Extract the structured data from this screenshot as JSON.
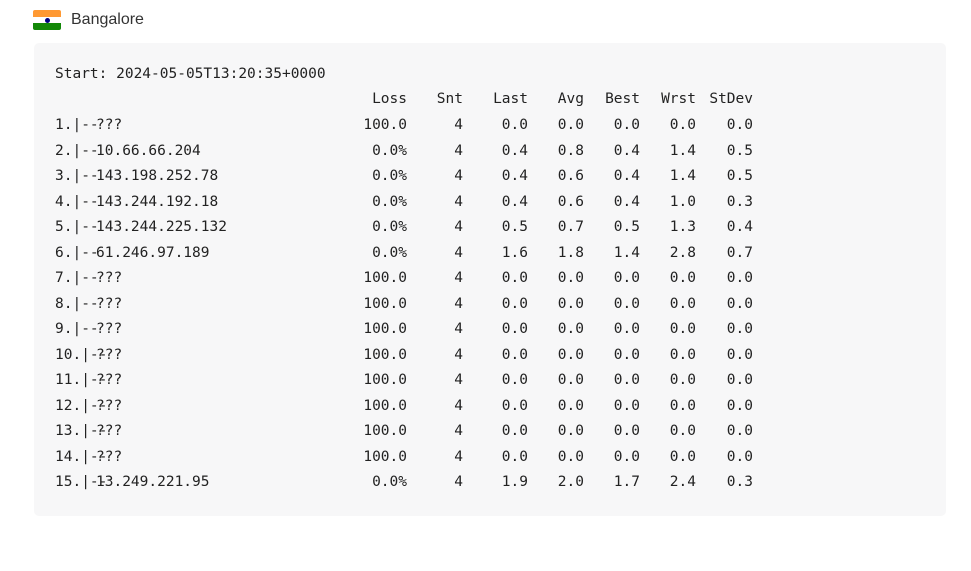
{
  "location": {
    "flag_icon": "india-flag-icon",
    "name": "Bangalore"
  },
  "report": {
    "start": "Start: 2024-05-05T13:20:35+0000",
    "columns": {
      "loss": "Loss",
      "snt": "Snt",
      "last": "Last",
      "avg": "Avg",
      "best": "Best",
      "wrst": "Wrst",
      "stdev": "StDev"
    },
    "hops": [
      {
        "hop": "1.|--",
        "host": "???",
        "loss": "100.0",
        "snt": "4",
        "last": "0.0",
        "avg": "0.0",
        "best": "0.0",
        "wrst": "0.0",
        "stdev": "0.0"
      },
      {
        "hop": "2.|--",
        "host": "10.66.66.204",
        "loss": "0.0%",
        "snt": "4",
        "last": "0.4",
        "avg": "0.8",
        "best": "0.4",
        "wrst": "1.4",
        "stdev": "0.5"
      },
      {
        "hop": "3.|--",
        "host": "143.198.252.78",
        "loss": "0.0%",
        "snt": "4",
        "last": "0.4",
        "avg": "0.6",
        "best": "0.4",
        "wrst": "1.4",
        "stdev": "0.5"
      },
      {
        "hop": "4.|--",
        "host": "143.244.192.18",
        "loss": "0.0%",
        "snt": "4",
        "last": "0.4",
        "avg": "0.6",
        "best": "0.4",
        "wrst": "1.0",
        "stdev": "0.3"
      },
      {
        "hop": "5.|--",
        "host": "143.244.225.132",
        "loss": "0.0%",
        "snt": "4",
        "last": "0.5",
        "avg": "0.7",
        "best": "0.5",
        "wrst": "1.3",
        "stdev": "0.4"
      },
      {
        "hop": "6.|--",
        "host": "61.246.97.189",
        "loss": "0.0%",
        "snt": "4",
        "last": "1.6",
        "avg": "1.8",
        "best": "1.4",
        "wrst": "2.8",
        "stdev": "0.7"
      },
      {
        "hop": "7.|--",
        "host": "???",
        "loss": "100.0",
        "snt": "4",
        "last": "0.0",
        "avg": "0.0",
        "best": "0.0",
        "wrst": "0.0",
        "stdev": "0.0"
      },
      {
        "hop": "8.|--",
        "host": "???",
        "loss": "100.0",
        "snt": "4",
        "last": "0.0",
        "avg": "0.0",
        "best": "0.0",
        "wrst": "0.0",
        "stdev": "0.0"
      },
      {
        "hop": "9.|--",
        "host": "???",
        "loss": "100.0",
        "snt": "4",
        "last": "0.0",
        "avg": "0.0",
        "best": "0.0",
        "wrst": "0.0",
        "stdev": "0.0"
      },
      {
        "hop": "10.|--",
        "host": "???",
        "loss": "100.0",
        "snt": "4",
        "last": "0.0",
        "avg": "0.0",
        "best": "0.0",
        "wrst": "0.0",
        "stdev": "0.0"
      },
      {
        "hop": "11.|--",
        "host": "???",
        "loss": "100.0",
        "snt": "4",
        "last": "0.0",
        "avg": "0.0",
        "best": "0.0",
        "wrst": "0.0",
        "stdev": "0.0"
      },
      {
        "hop": "12.|--",
        "host": "???",
        "loss": "100.0",
        "snt": "4",
        "last": "0.0",
        "avg": "0.0",
        "best": "0.0",
        "wrst": "0.0",
        "stdev": "0.0"
      },
      {
        "hop": "13.|--",
        "host": "???",
        "loss": "100.0",
        "snt": "4",
        "last": "0.0",
        "avg": "0.0",
        "best": "0.0",
        "wrst": "0.0",
        "stdev": "0.0"
      },
      {
        "hop": "14.|--",
        "host": "???",
        "loss": "100.0",
        "snt": "4",
        "last": "0.0",
        "avg": "0.0",
        "best": "0.0",
        "wrst": "0.0",
        "stdev": "0.0"
      },
      {
        "hop": "15.|--",
        "host": "13.249.221.95",
        "loss": "0.0%",
        "snt": "4",
        "last": "1.9",
        "avg": "2.0",
        "best": "1.7",
        "wrst": "2.4",
        "stdev": "0.3"
      }
    ]
  }
}
